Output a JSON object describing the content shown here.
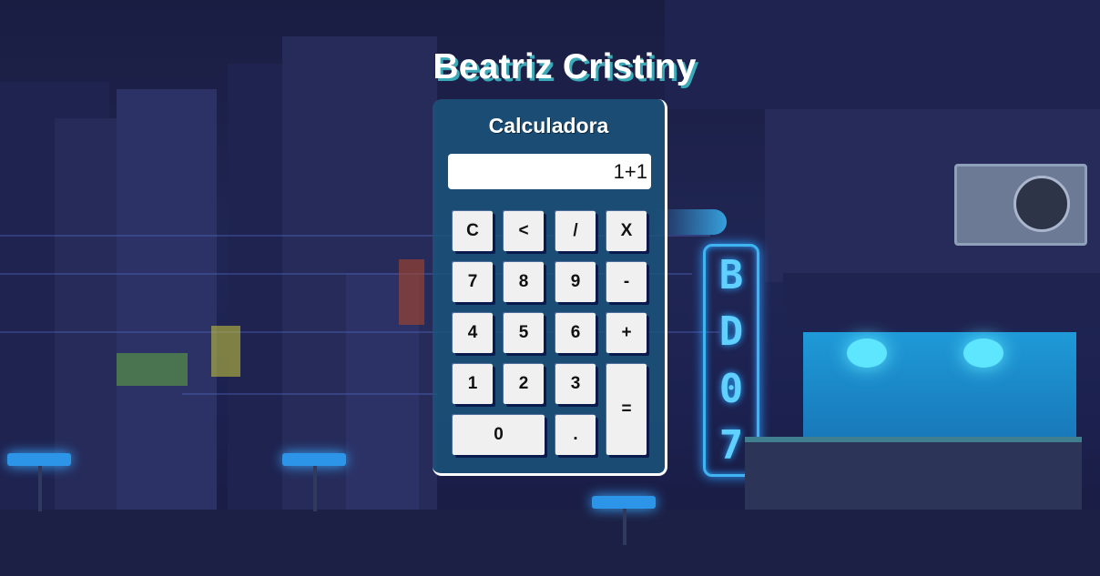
{
  "page": {
    "title": "Beatriz Cristiny"
  },
  "calculator": {
    "title": "Calculadora",
    "display_value": "1+1",
    "buttons": {
      "clear": "C",
      "backspace": "<",
      "divide": "/",
      "multiply": "X",
      "seven": "7",
      "eight": "8",
      "nine": "9",
      "minus": "-",
      "four": "4",
      "five": "5",
      "six": "6",
      "plus": "+",
      "one": "1",
      "two": "2",
      "three": "3",
      "equals": "=",
      "zero": "0",
      "decimal": "."
    }
  },
  "background": {
    "sign_letters": [
      "B",
      "D",
      "0",
      "7"
    ]
  },
  "colors": {
    "panel": "#1b567c",
    "title_shadow": "#3aa9b8",
    "button_face": "#f0f0f0",
    "button_shadow": "#0b1a4d",
    "neon": "#3fb4f0"
  }
}
